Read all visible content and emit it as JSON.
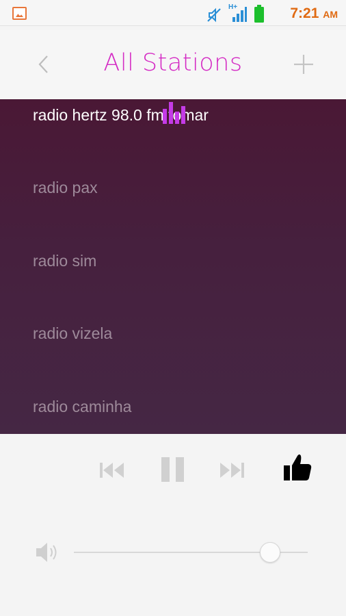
{
  "status_bar": {
    "time": "7:21",
    "ampm": "AM",
    "network": "H+",
    "icons": [
      "gallery-icon",
      "mute-icon",
      "signal-icon",
      "battery-icon"
    ]
  },
  "header": {
    "title": "All Stations",
    "back_icon": "chevron-left-icon",
    "add_icon": "plus-icon"
  },
  "stations": [
    {
      "name": "radio hertz 98.0 fm tomar",
      "active": true
    },
    {
      "name": "radio pax",
      "active": false
    },
    {
      "name": "radio sim",
      "active": false
    },
    {
      "name": "radio vizela",
      "active": false
    },
    {
      "name": "radio caminha",
      "active": false
    }
  ],
  "player": {
    "prev_icon": "skip-previous-icon",
    "pause_icon": "pause-icon",
    "next_icon": "skip-next-icon",
    "like_icon": "thumbs-up-icon",
    "volume_icon": "volume-icon",
    "volume_level": 0.84
  },
  "colors": {
    "accent": "#d42ac4",
    "equalizer": "#c43be6",
    "list_bg_top": "#4a1835",
    "list_bg_bottom": "#452744",
    "time": "#e06a12",
    "status_icons": "#2a8fd6",
    "battery": "#1cbf2c"
  }
}
